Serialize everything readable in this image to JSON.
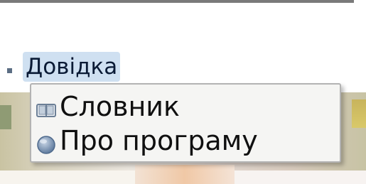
{
  "menu": {
    "title": "Довідка",
    "items": [
      {
        "label": "Словник",
        "icon": "book-icon"
      },
      {
        "label": "Про програму",
        "icon": "info-globe-icon"
      }
    ]
  },
  "colors": {
    "menu_highlight": "#cfe0f1",
    "dropdown_bg": "#f5f5f3",
    "dropdown_border": "#b3b3b3"
  }
}
